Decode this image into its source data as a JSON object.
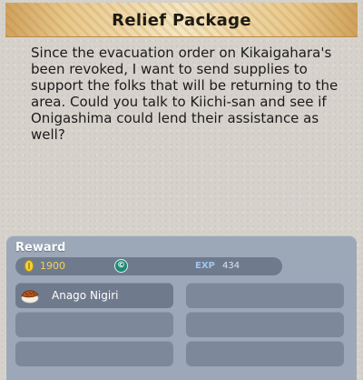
{
  "quest": {
    "title": "Relief Package",
    "description": "Since the evacuation order on Kikaigahara's\nbeen revoked, I want to send supplies to\nsupport the folks that will be returning to the\narea. Could you talk to Kiichi-san and see if\nOnigashima could lend their assistance as well?"
  },
  "reward": {
    "header": "Reward",
    "coins": "1900",
    "coin_icon": "gold-coin-icon",
    "currency_icon": "c-currency-icon",
    "currency_glyph": "©",
    "exp_label": "EXP",
    "exp_value": "434",
    "items": [
      {
        "label": "Anago Nigiri",
        "icon": "anago-nigiri-icon"
      }
    ],
    "empty_slots": 5
  },
  "colors": {
    "title_gold": "#e8c98d",
    "reward_panel": "#9ca8b8",
    "slot": "#7d899b",
    "coin": "#f5d23a",
    "exp_label": "#9fc6f0"
  }
}
